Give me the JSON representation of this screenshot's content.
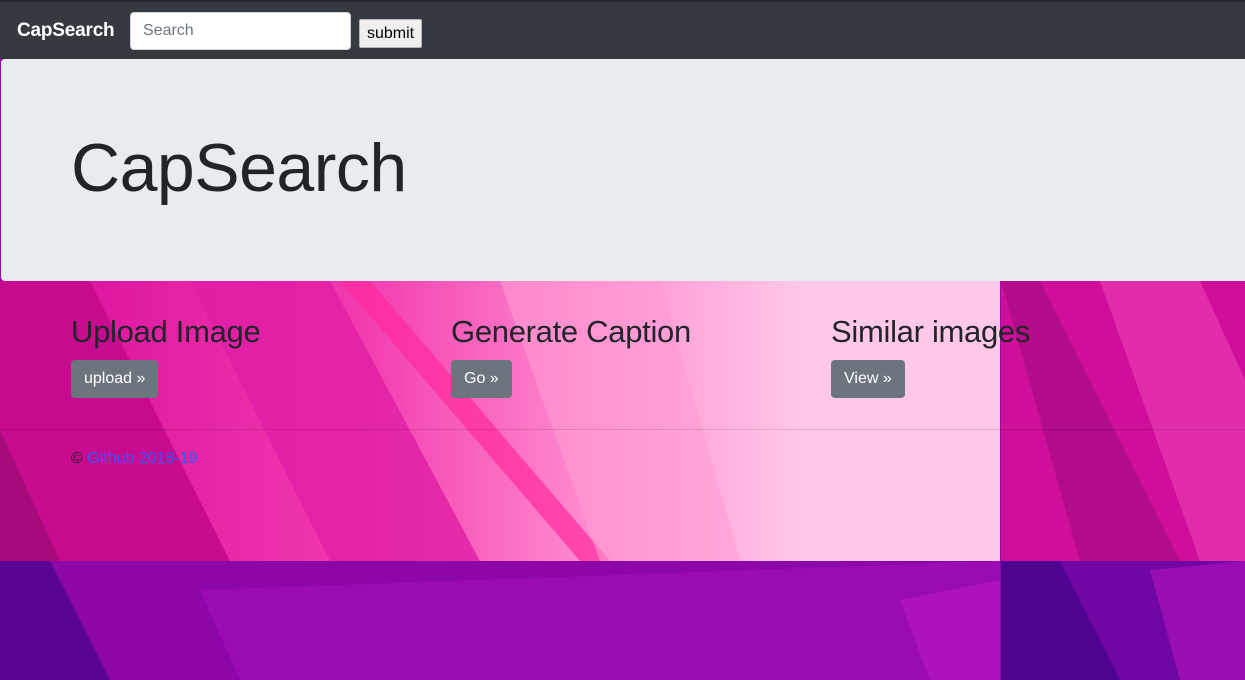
{
  "navbar": {
    "brand": "CapSearch",
    "search_placeholder": "Search",
    "submit_label": "submit"
  },
  "jumbotron": {
    "title": "CapSearch"
  },
  "features": [
    {
      "heading": "Upload Image",
      "button": "upload »"
    },
    {
      "heading": "Generate Caption",
      "button": "Go »"
    },
    {
      "heading": "Similar images",
      "button": "View »"
    }
  ],
  "footer": {
    "copyright": "©",
    "link_text": "Github 2018-19"
  },
  "colors": {
    "navbar_bg": "#343a40",
    "jumbotron_bg": "#e9ecef",
    "button_bg": "#6c757d",
    "link": "#2b5cff",
    "pink": "#f02aa8",
    "purple": "#9a0bb0"
  }
}
